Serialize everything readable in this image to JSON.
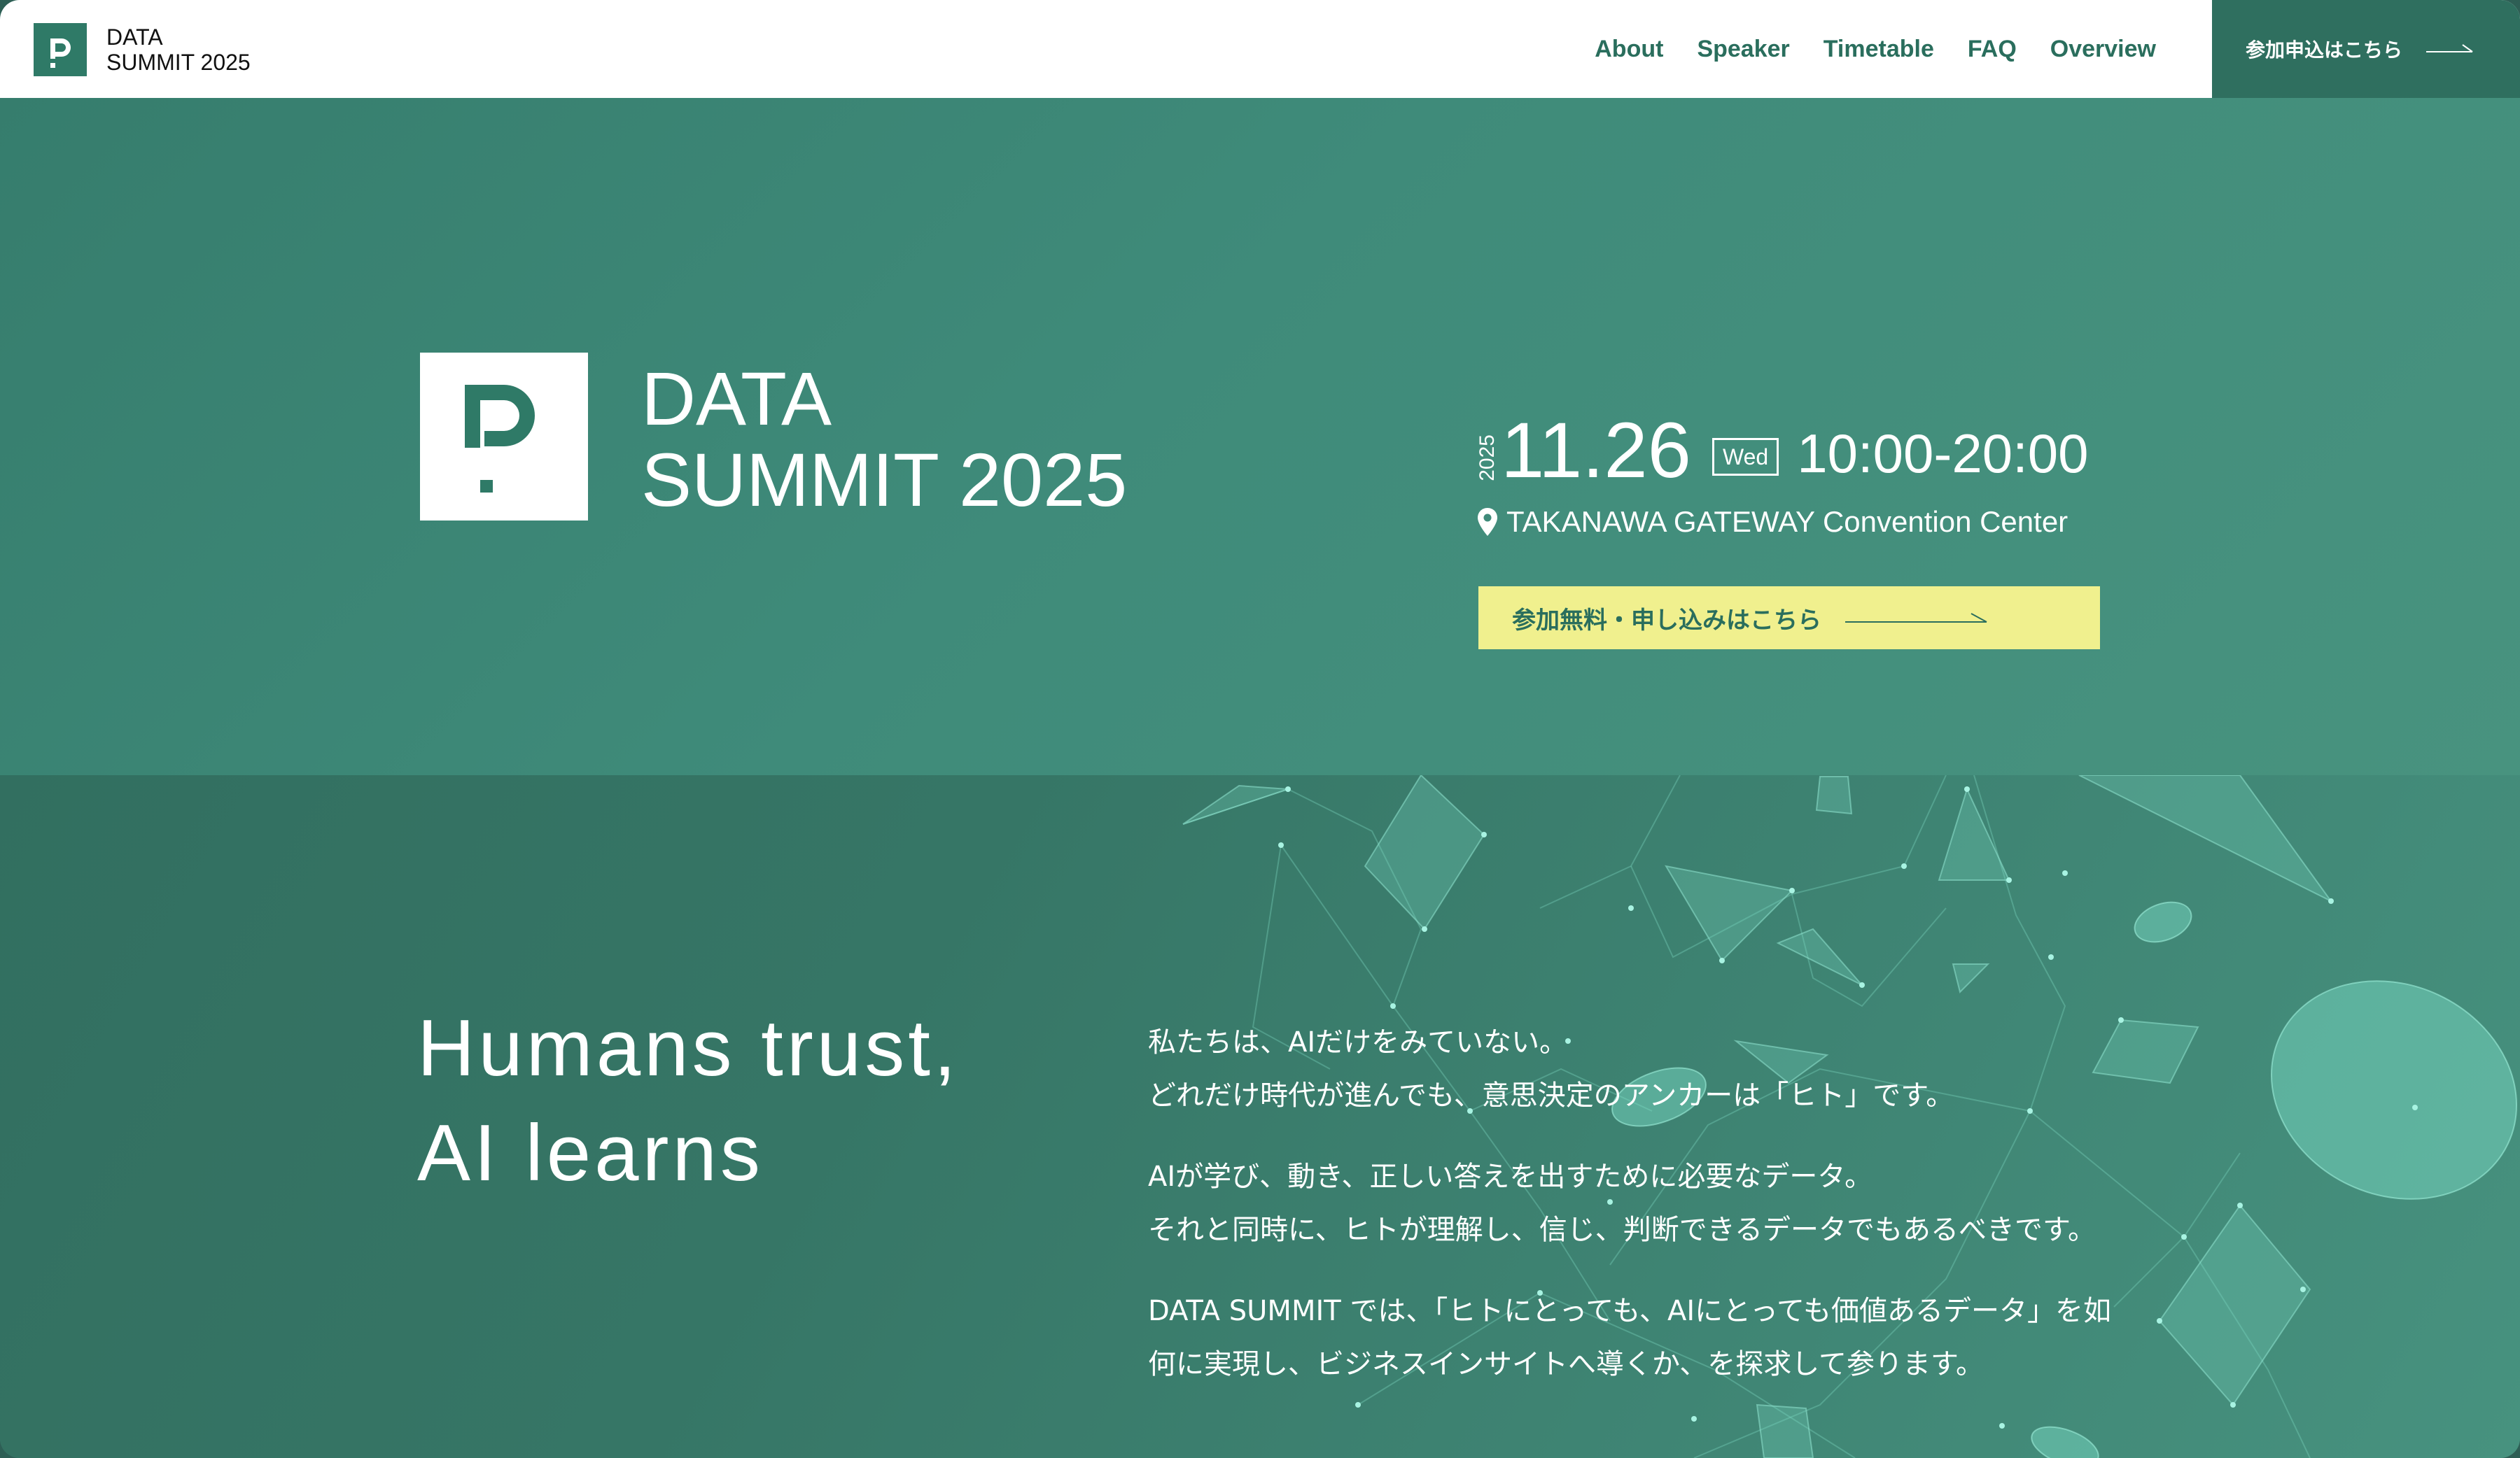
{
  "header": {
    "brand_line1": "DATA",
    "brand_line2": "SUMMIT 2025",
    "nav": [
      {
        "label": "About"
      },
      {
        "label": "Speaker"
      },
      {
        "label": "Timetable"
      },
      {
        "label": "FAQ"
      },
      {
        "label": "Overview"
      }
    ],
    "cta_label": "参加申込はこちら"
  },
  "hero": {
    "title_line1": "DATA",
    "title_line2": "SUMMIT 2025",
    "year": "2025",
    "date": "11.26",
    "day_of_week": "Wed",
    "time": "10:00-20:00",
    "venue": "TAKANAWA GATEWAY Convention Center",
    "cta_label": "参加無料・申し込みはこちら"
  },
  "concept": {
    "headline_line1": "Humans trust,",
    "headline_line2": "AI learns",
    "paragraphs": [
      {
        "line1": "私たちは、AIだけをみていない。",
        "line2": "どれだけ時代が進んでも、意思決定のアンカーは「ヒト」です。"
      },
      {
        "line1": "AIが学び、動き、正しい答えを出すために必要なデータ。",
        "line2": "それと同時に、ヒトが理解し、信じ、判断できるデータでもあるべきです。"
      },
      {
        "line1": "DATA SUMMIT では、「ヒトにとっても、AIにとっても価値あるデータ」を如",
        "line2": "何に実現し、ビジネスインサイトへ導くか、を探求して参ります。"
      }
    ]
  },
  "colors": {
    "brand_green": "#2f7a67",
    "hero_bg": "#3f8b7a",
    "cta_yellow": "#f0f08e",
    "nav_text": "#2a6e5d"
  }
}
